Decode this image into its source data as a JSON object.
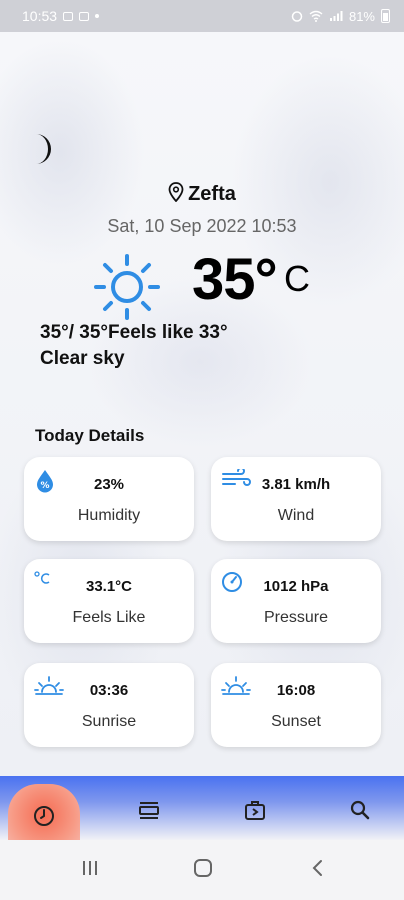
{
  "status_bar": {
    "time": "10:53",
    "battery": "81%"
  },
  "weather": {
    "location": "Zefta",
    "datetime": "Sat, 10 Sep 2022 10:53",
    "temperature": "35°",
    "temperature_unit": "C",
    "min_max": "35°/ 35°",
    "feels_like_text": "Feels like 33°",
    "description": "Clear sky",
    "icon": "sun-icon",
    "night_icon": "moon-icon"
  },
  "today_details": {
    "title": "Today Details",
    "cards": [
      {
        "icon": "humidity-icon",
        "value": "23%",
        "label": "Humidity"
      },
      {
        "icon": "wind-icon",
        "value": "3.81 km/h",
        "label": "Wind"
      },
      {
        "icon": "celsius-icon",
        "value": "33.1°C",
        "label": "Feels Like"
      },
      {
        "icon": "pressure-gauge-icon",
        "value": "1012 hPa",
        "label": "Pressure"
      },
      {
        "icon": "sunrise-icon",
        "value": "03:36",
        "label": "Sunrise"
      },
      {
        "icon": "sunset-icon",
        "value": "16:08",
        "label": "Sunset"
      }
    ]
  },
  "bottom_nav": {
    "items": [
      "clock-icon",
      "list-icon",
      "forecast-icon",
      "search-icon"
    ],
    "active": "clock-icon"
  },
  "colors": {
    "accent_blue": "#2f8de4",
    "nav_blue": "#4a72f0",
    "active_tab": "#f56b52"
  }
}
